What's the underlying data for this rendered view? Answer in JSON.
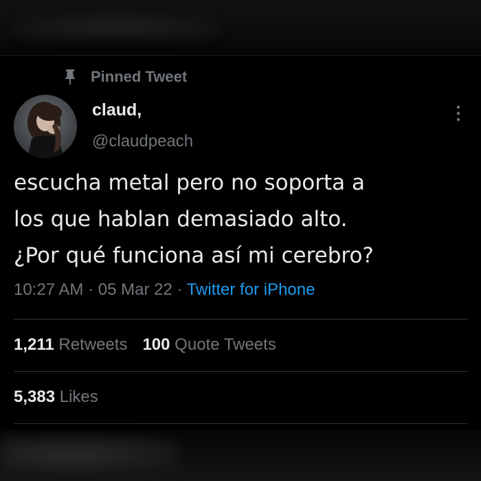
{
  "pinned": {
    "label": "Pinned Tweet",
    "icon": "pin-icon"
  },
  "author": {
    "name": "claud,",
    "handle": "@claudpeach",
    "avatar_icon": "avatar"
  },
  "more_icon": "more-vertical-icon",
  "tweet": {
    "lines": [
      "escucha metal pero no soporta a",
      "los que hablan demasiado alto.",
      "¿Por qué funciona así mi cerebro?"
    ]
  },
  "meta": {
    "time": "10:27 AM",
    "separator": " · ",
    "date": "05 Mar 22",
    "source": "Twitter for iPhone"
  },
  "stats": {
    "retweets_count": "1,211",
    "retweets_label": "Retweets",
    "quotes_count": "100",
    "quotes_label": "Quote Tweets",
    "likes_count": "5,383",
    "likes_label": "Likes"
  },
  "colors": {
    "background": "#000000",
    "text_primary": "#e7e9ea",
    "text_secondary": "#71767b",
    "link_blue": "#1d9bf0",
    "divider": "#2f3336"
  }
}
